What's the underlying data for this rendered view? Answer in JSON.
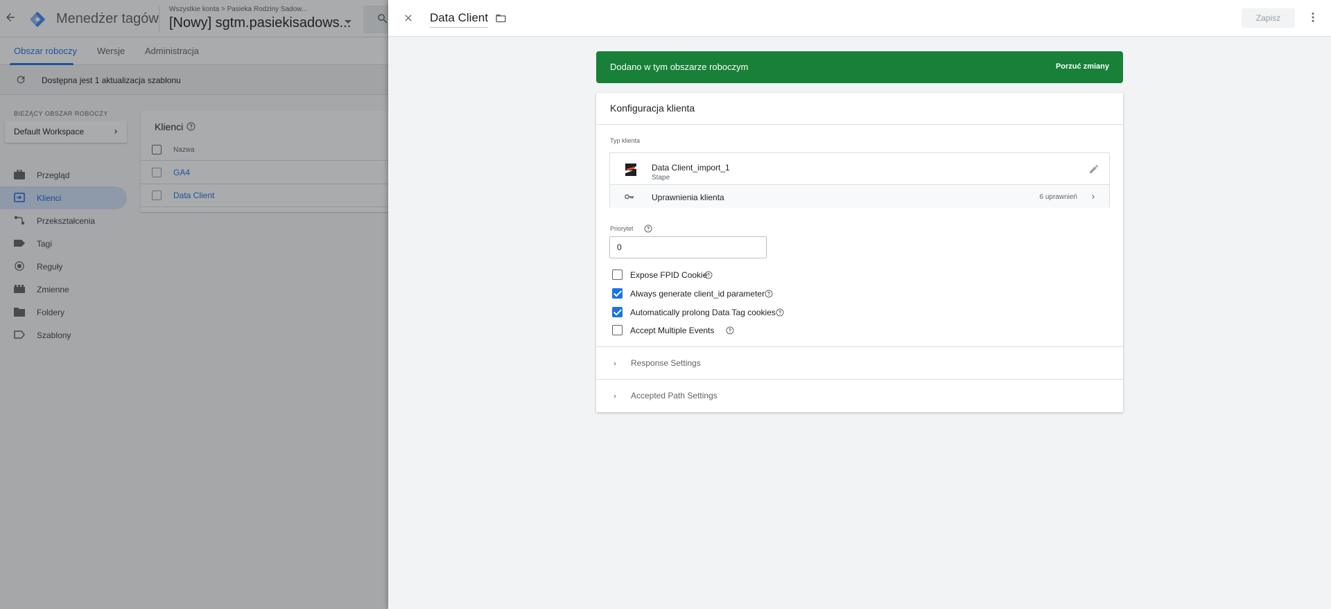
{
  "app": {
    "title": "Menedżer tagów",
    "breadcrumb": "Wszystkie konta > Pasieka Rodziny Sadow...",
    "container_name": "[Nowy] sgtm.pasiekisadows..."
  },
  "nav_tabs": [
    {
      "label": "Obszar roboczy",
      "active": true
    },
    {
      "label": "Wersje",
      "active": false
    },
    {
      "label": "Administracja",
      "active": false
    }
  ],
  "update_bar": {
    "text": "Dostępna jest 1 aktualizacja szablonu"
  },
  "workspace": {
    "label": "BIEŻĄCY OBSZAR ROBOCZY",
    "name": "Default Workspace"
  },
  "sidebar": {
    "items": [
      {
        "label": "Przegląd",
        "icon": "briefcase-icon",
        "active": false
      },
      {
        "label": "Klienci",
        "icon": "clients-icon",
        "active": true
      },
      {
        "label": "Przekształcenia",
        "icon": "transform-icon",
        "active": false
      },
      {
        "label": "Tagi",
        "icon": "tag-icon",
        "active": false
      },
      {
        "label": "Reguły",
        "icon": "trigger-icon",
        "active": false
      },
      {
        "label": "Zmienne",
        "icon": "variable-icon",
        "active": false
      },
      {
        "label": "Foldery",
        "icon": "folder-icon",
        "active": false
      },
      {
        "label": "Szablony",
        "icon": "template-icon",
        "active": false
      }
    ]
  },
  "clients_list": {
    "title": "Klienci",
    "column": "Nazwa",
    "rows": [
      {
        "name": "GA4"
      },
      {
        "name": "Data Client"
      }
    ]
  },
  "panel": {
    "title": "Data Client",
    "save_label": "Zapisz",
    "banner": {
      "text": "Dodano w tym obszarze roboczym",
      "action": "Porzuć zmiany"
    },
    "config": {
      "title": "Konfiguracja klienta",
      "type_label": "Typ klienta",
      "type_name": "Data Client_import_1",
      "type_vendor": "Stape",
      "permissions_label": "Uprawnienia klienta",
      "permissions_count": "6 uprawnień",
      "priority_label": "Priorytet",
      "priority_value": "0",
      "checkboxes": [
        {
          "label": "Expose FPID Cookie",
          "checked": false
        },
        {
          "label": "Always generate client_id parameter",
          "checked": true
        },
        {
          "label": "Automatically prolong Data Tag cookies",
          "checked": true
        },
        {
          "label": "Accept Multiple Events",
          "checked": false
        }
      ],
      "sections": [
        {
          "label": "Response Settings"
        },
        {
          "label": "Accepted Path Settings"
        }
      ]
    }
  },
  "colors": {
    "accent": "#1a73e8",
    "success": "#188038",
    "active_nav_bg": "#d2e3fc"
  }
}
